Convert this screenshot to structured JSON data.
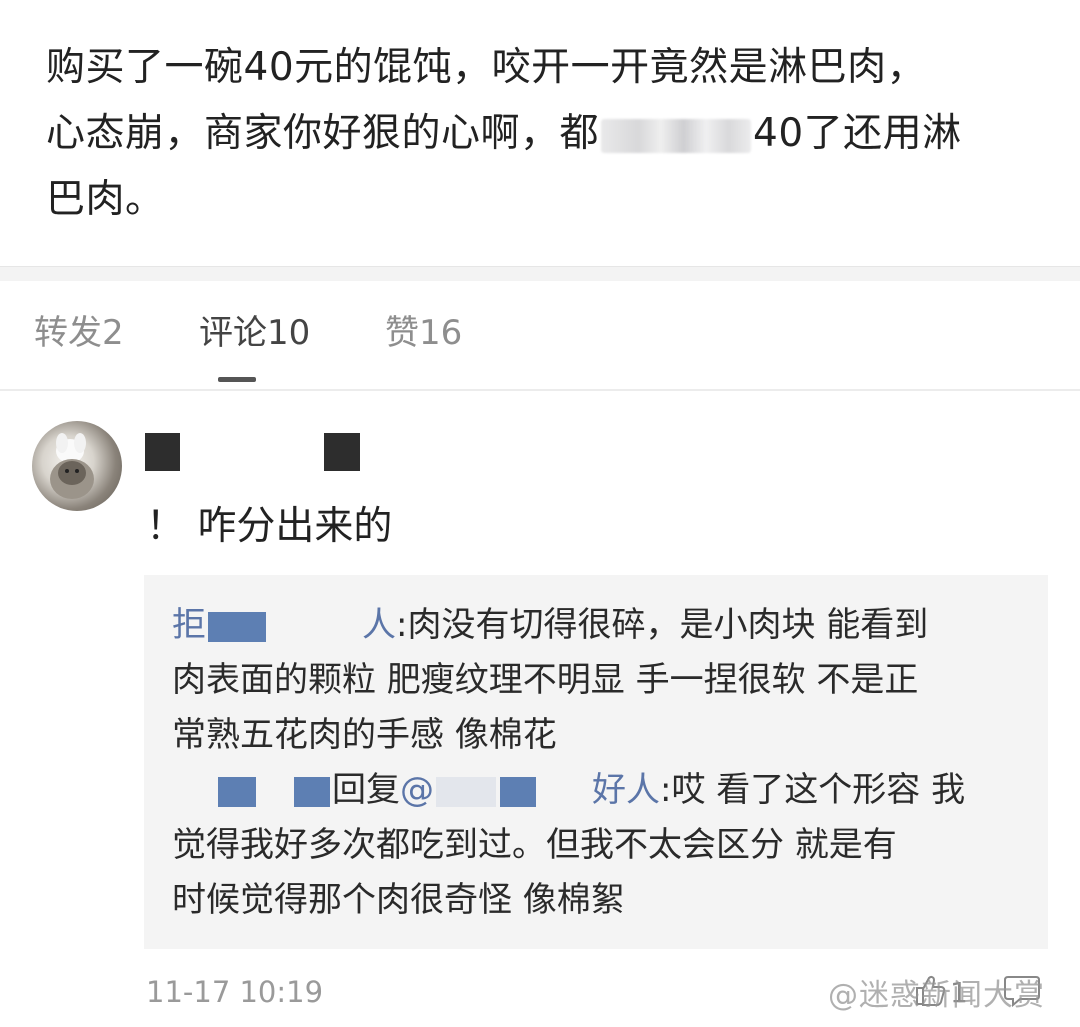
{
  "post": {
    "line1": "购买了一碗40元的馄饨，咬开一开竟然是淋巴肉，",
    "line2_start": "心态崩，商家你好狠的心啊，都",
    "line2_end": "40了还用淋",
    "line3": "巴肉。"
  },
  "tabs": [
    {
      "label": "转发2"
    },
    {
      "label": "评论10"
    },
    {
      "label": "赞16"
    }
  ],
  "comment": {
    "text": "！ 咋分出来的",
    "timestamp": "11-17 10:19",
    "like_count": "1"
  },
  "reply": {
    "name1_first": "拒",
    "name1_last": "人",
    "text1_a": ":肉没有切得很碎，是小肉块 能看到",
    "text1_b": "肉表面的颗粒 肥瘦纹理不明显 手一捏很软 不是正",
    "text1_c": "常熟五花肉的手感 像棉花",
    "reply_word": "回复",
    "at": "@",
    "name2_last": "好人",
    "text2_a": ":哎 看了这个形容 我",
    "text2_b": "觉得我好多次都吃到过。但我不太会区分 就是有",
    "text2_c": "时候觉得那个肉很奇怪 像棉絮"
  },
  "watermark": "@迷惑新闻大赏",
  "colors": {
    "link": "#5b75a8",
    "timestamp": "#9a9a9a",
    "tab_active": "#444444",
    "tab_inactive": "#8e8e8e"
  }
}
